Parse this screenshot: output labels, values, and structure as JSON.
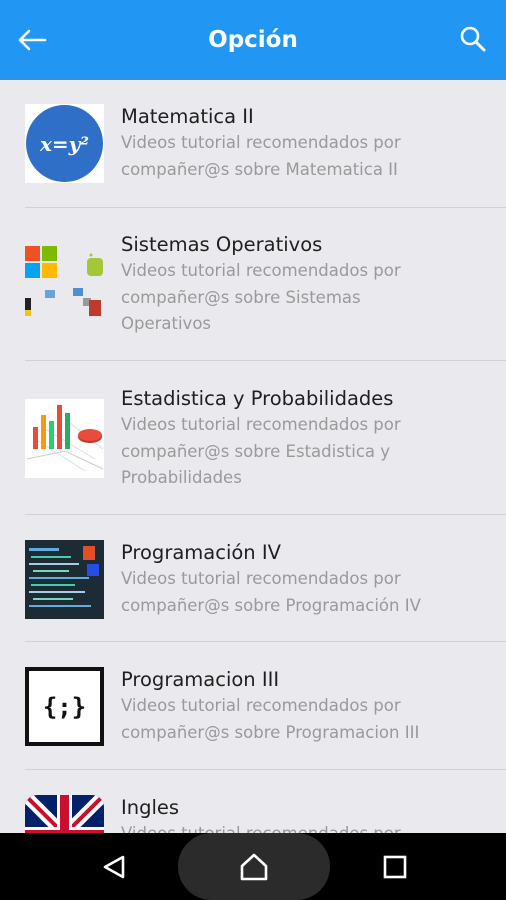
{
  "appbar": {
    "title": "Opción"
  },
  "items": [
    {
      "title": "Matematica II",
      "desc_lines": [
        "Videos tutorial recomendados por",
        "compañer@s sobre Matematica II"
      ]
    },
    {
      "title": "Sistemas Operativos",
      "desc_lines": [
        "Videos tutorial recomendados por",
        "compañer@s sobre Sistemas",
        "Operativos"
      ]
    },
    {
      "title": "Estadistica y Probabilidades",
      "desc_lines": [
        "Videos tutorial recomendados por",
        "compañer@s sobre Estadistica y",
        "Probabilidades"
      ]
    },
    {
      "title": "Programación IV",
      "desc_lines": [
        "Videos tutorial recomendados por",
        "compañer@s sobre Programación IV"
      ]
    },
    {
      "title": "Programacion III",
      "desc_lines": [
        "Videos tutorial recomendados por",
        "compañer@s sobre Programacion III"
      ]
    },
    {
      "title": "Ingles",
      "desc_lines": [
        "Videos tutorial recomendados por"
      ]
    }
  ],
  "thumbs": {
    "matematica": "x=y²",
    "programacion_iii": "{;}"
  },
  "colors": {
    "appbar": "#2196f3",
    "background": "#e9e9ee",
    "navbar": "#000000"
  }
}
